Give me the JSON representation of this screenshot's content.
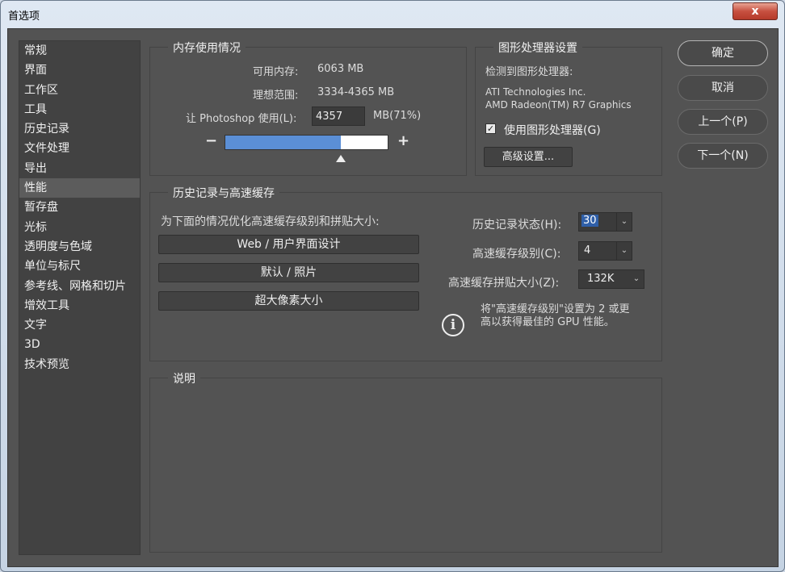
{
  "window": {
    "title": "首选项",
    "close_label": "x"
  },
  "sidebar": {
    "items": [
      "常规",
      "界面",
      "工作区",
      "工具",
      "历史记录",
      "文件处理",
      "导出",
      "性能",
      "暂存盘",
      "光标",
      "透明度与色域",
      "单位与标尺",
      "参考线、网格和切片",
      "增效工具",
      "文字",
      "3D",
      "技术预览"
    ],
    "selected_index": 7
  },
  "memory": {
    "title": "内存使用情况",
    "available_label": "可用内存:",
    "available_value": "6063 MB",
    "ideal_label": "理想范围:",
    "ideal_value": "3334-4365 MB",
    "let_label": "让 Photoshop 使用(L):",
    "let_value": "4357",
    "let_unit": "MB(71%)",
    "slider_percent": 71,
    "minus_label": "−",
    "plus_label": "+"
  },
  "gpu": {
    "title": "图形处理器设置",
    "detected_label": "检测到图形处理器:",
    "vendor": "ATI Technologies Inc.",
    "model": "AMD Radeon(TM) R7 Graphics",
    "use_gpu_label": "使用图形处理器(G)",
    "use_gpu_checked": true,
    "advanced_button": "高级设置..."
  },
  "history_cache": {
    "title": "历史记录与高速缓存",
    "optimize_label": "为下面的情况优化高速缓存级别和拼贴大小:",
    "preset_buttons": [
      "Web / 用户界面设计",
      "默认 / 照片",
      "超大像素大小"
    ],
    "history_states_label": "历史记录状态(H):",
    "history_states_value": "30",
    "cache_levels_label": "高速缓存级别(C):",
    "cache_levels_value": "4",
    "tile_size_label": "高速缓存拼贴大小(Z):",
    "tile_size_value": "132K",
    "tip_line1": "将\"高速缓存级别\"设置为 2 或更",
    "tip_line2": "高以获得最佳的 GPU 性能。"
  },
  "description": {
    "title": "说明"
  },
  "buttons": {
    "ok": "确定",
    "cancel": "取消",
    "prev": "上一个(P)",
    "next": "下一个(N)"
  },
  "colors": {
    "panel": "#535353",
    "sidebar": "#424242",
    "accent": "#5b8fd6",
    "selected": "#5c5c5c"
  },
  "icons": {
    "close": "close-icon",
    "checkbox": "checkmark-icon",
    "info": "info-icon",
    "dropdown": "chevron-down-icon"
  }
}
